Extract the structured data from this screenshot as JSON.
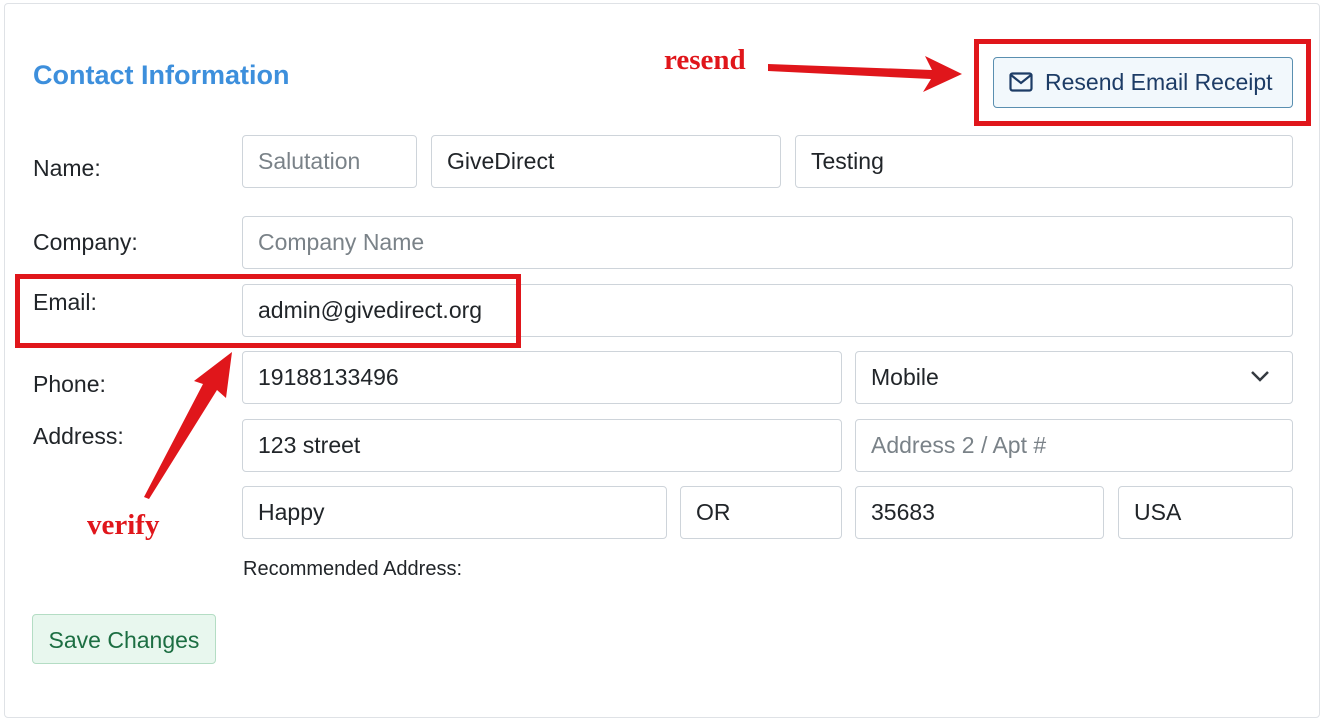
{
  "form": {
    "title": "Contact Information",
    "labels": {
      "name": "Name:",
      "company": "Company:",
      "email": "Email:",
      "phone": "Phone:",
      "address": "Address:"
    },
    "name": {
      "salutation_placeholder": "Salutation",
      "first_name": "GiveDirect",
      "last_name": "Testing"
    },
    "company_placeholder": "Company Name",
    "email": "admin@givedirect.org",
    "phone": {
      "number": "19188133496",
      "type": "Mobile"
    },
    "address": {
      "line1": "123 street",
      "line2_placeholder": "Address 2 / Apt #",
      "city": "Happy",
      "state": "OR",
      "zip": "35683",
      "country": "USA"
    },
    "recommended_address_label": "Recommended Address:",
    "resend_button": "Resend Email Receipt",
    "save_button": "Save Changes"
  },
  "annotations": {
    "resend": "resend",
    "verify": "verify",
    "color": "#e0161b"
  },
  "icons": {
    "resend": "envelope-icon",
    "phone_type": "chevron-down-icon"
  },
  "colors": {
    "title": "#3d8fdc",
    "save_button_bg": "#e8f7ee",
    "resend_button_bg": "#f2f8fc"
  }
}
